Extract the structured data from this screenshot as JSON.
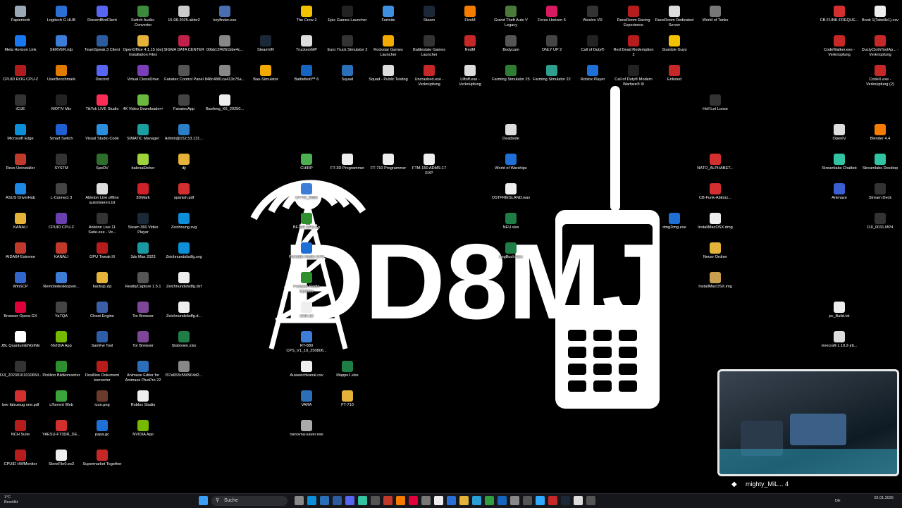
{
  "wallpaper": {
    "callsign": "DD8MJ"
  },
  "icons": [
    {
      "label": "Papierkorb",
      "color": "#9aa7b4",
      "icon": "recycle-bin-icon"
    },
    {
      "label": "Logitech G HUB",
      "color": "#2a6fd6",
      "icon": "logitech-icon"
    },
    {
      "label": "DiscordBotClient",
      "color": "#5865f2",
      "icon": "discord-icon"
    },
    {
      "label": "Switch Audio-Converter",
      "color": "#3b8b3b",
      "icon": "audio-converter-icon"
    },
    {
      "label": "15-08-2025.abbv2",
      "color": "#cccccc",
      "icon": "file-icon"
    },
    {
      "label": "keyfinder.exe",
      "color": "#4a6fb0",
      "icon": "app-icon"
    },
    {
      "label": "Meta Horizon Link",
      "color": "#1877f2",
      "icon": "meta-icon"
    },
    {
      "label": "SERVER.rdp",
      "color": "#3d7dd8",
      "icon": "rdp-icon"
    },
    {
      "label": "TeamSpeak 3 Client",
      "color": "#2c5b9e",
      "icon": "teamspeak-icon"
    },
    {
      "label": "OpenOffice 4.1.15 (de) Installation Files",
      "color": "#e5b23a",
      "icon": "folder-icon"
    },
    {
      "label": "SIGMA DATA CENTER",
      "color": "#c0204a",
      "icon": "sigma-icon"
    },
    {
      "label": "00bb12f4261bbe4c...",
      "color": "#888888",
      "icon": "file-icon"
    },
    {
      "label": "CPUID ROG CPU-Z",
      "color": "#b01c1c",
      "icon": "cpuz-icon"
    },
    {
      "label": "UserBenchmark",
      "color": "#e07b00",
      "icon": "benchmark-icon"
    },
    {
      "label": "Discord",
      "color": "#5865f2",
      "icon": "discord-icon"
    },
    {
      "label": "Virtual CloneDrive",
      "color": "#7a3fb8",
      "icon": "clonedrive-icon"
    },
    {
      "label": "Fanatec Control Panel",
      "color": "#555555",
      "icon": "fanatec-icon"
    },
    {
      "label": "848c4881ca413c75a...",
      "color": "#888888",
      "icon": "file-icon"
    },
    {
      "label": "iCUE",
      "color": "#333333",
      "icon": "icue-icon"
    },
    {
      "label": "MOTIV Mix",
      "color": "#222222",
      "icon": "motiv-icon"
    },
    {
      "label": "TikTok LIVE Studio",
      "color": "#fe2c55",
      "icon": "tiktok-icon"
    },
    {
      "label": "4K Video Downloader+",
      "color": "#69b83f",
      "icon": "video-downloader-icon"
    },
    {
      "label": "FanatecApp",
      "color": "#444444",
      "icon": "fanatec-icon"
    },
    {
      "label": "Baofeng_K6_20250...",
      "color": "#eeeeee",
      "icon": "file-icon"
    },
    {
      "label": "Microsoft Edge",
      "color": "#0c8fd8",
      "icon": "edge-icon"
    },
    {
      "label": "Smart Switch",
      "color": "#1f5fd1",
      "icon": "smart-switch-icon"
    },
    {
      "label": "Visual Studio Code",
      "color": "#2b8fe0",
      "icon": "vscode-icon"
    },
    {
      "label": "SIMATIC Manager",
      "color": "#1aa0a0",
      "icon": "simatic-icon"
    },
    {
      "label": "Admin@152.53.131...",
      "color": "#2a7fc8",
      "icon": "rdp-icon"
    },
    {
      "label": "Revo Uninstaller",
      "color": "#c0392b",
      "icon": "revo-icon"
    },
    {
      "label": "SYSTM",
      "color": "#333333",
      "icon": "systm-icon"
    },
    {
      "label": "SpeDV",
      "color": "#2d6e2d",
      "icon": "spedv-icon"
    },
    {
      "label": "balenaEtcher",
      "color": "#9ed33c",
      "icon": "etcher-icon"
    },
    {
      "label": "dji",
      "color": "#e5b23a",
      "icon": "folder-icon"
    },
    {
      "label": "ASUS DriverHub",
      "color": "#1e88e5",
      "icon": "asus-icon"
    },
    {
      "label": "L-Connect 3",
      "color": "#444444",
      "icon": "lconnect-icon"
    },
    {
      "label": "Ableton Live offline autorisieren.txt",
      "color": "#dddddd",
      "icon": "text-file-icon"
    },
    {
      "label": "3DMark",
      "color": "#d0202a",
      "icon": "3dmark-icon"
    },
    {
      "label": "spanish.pdf",
      "color": "#d32f2f",
      "icon": "pdf-icon"
    },
    {
      "label": "KANALI",
      "color": "#e5b23a",
      "icon": "folder-icon"
    },
    {
      "label": "CPUID CPU-Z",
      "color": "#6b3fb0",
      "icon": "cpuz-icon"
    },
    {
      "label": "Ableton Live 11 Suite.exe - Ve...",
      "color": "#333333",
      "icon": "ableton-icon"
    },
    {
      "label": "Steam 360 Video Player",
      "color": "#1b2838",
      "icon": "steam-icon"
    },
    {
      "label": "Zeichnung.svg",
      "color": "#0c8fd8",
      "icon": "edge-icon"
    },
    {
      "label": "AIDA64 Extreme",
      "color": "#c0392b",
      "icon": "aida-icon"
    },
    {
      "label": "KANALI",
      "color": "#c0392b",
      "icon": "app-icon"
    },
    {
      "label": "GPU Tweak III",
      "color": "#b71c1c",
      "icon": "gpu-tweak-icon"
    },
    {
      "label": "3ds Max 2023",
      "color": "#1a9aa0",
      "icon": "3dsmax-icon"
    },
    {
      "label": "Zeichnundsfsdfg.svg",
      "color": "#0c8fd8",
      "icon": "edge-icon"
    },
    {
      "label": "WinSCP",
      "color": "#3366cc",
      "icon": "winscp-icon"
    },
    {
      "label": "Remotedesktopver...",
      "color": "#3d7dd8",
      "icon": "rdp-icon"
    },
    {
      "label": "backup.zip",
      "color": "#e5b23a",
      "icon": "zip-icon"
    },
    {
      "label": "RealityCapture 1.5.1",
      "color": "#555555",
      "icon": "realitycapture-icon"
    },
    {
      "label": "Zeichnundsfsdfg.dxf",
      "color": "#eeeeee",
      "icon": "file-icon"
    },
    {
      "label": "Browser Opera GX",
      "color": "#e0003a",
      "icon": "opera-icon"
    },
    {
      "label": "YaTQA",
      "color": "#444444",
      "icon": "yatqa-icon"
    },
    {
      "label": "Cheat Engine",
      "color": "#3a5fa8",
      "icon": "cheat-engine-icon"
    },
    {
      "label": "Tor Browser",
      "color": "#7d4698",
      "icon": "tor-icon"
    },
    {
      "label": "Zeichnundsfsdfg.d...",
      "color": "#eeeeee",
      "icon": "file-icon"
    },
    {
      "label": "JBL QuantumENGINE",
      "color": "#ffffff",
      "icon": "jbl-icon"
    },
    {
      "label": "NVIDIA App",
      "color": "#76b900",
      "icon": "nvidia-icon"
    },
    {
      "label": "SamFw Tool",
      "color": "#2f5ea8",
      "icon": "samfw-icon"
    },
    {
      "label": "Tor Browser",
      "color": "#7d4698",
      "icon": "tor-icon"
    },
    {
      "label": "Stationen.xlsx",
      "color": "#1e7e45",
      "icon": "excel-icon"
    },
    {
      "label": "DJI_20230101010650...",
      "color": "#333333",
      "icon": "video-file-icon"
    },
    {
      "label": "Pixillion Bildkonverter",
      "color": "#2d8f2d",
      "icon": "pixillion-icon"
    },
    {
      "label": "Doxillion Dokument konverter",
      "color": "#b71c1c",
      "icon": "doxillion-icon"
    },
    {
      "label": "Animaze Editor for Animaze PlusPro 22",
      "color": "#2b6fb8",
      "icon": "animaze-icon"
    },
    {
      "label": "f37a653c550904d2...",
      "color": "#888888",
      "icon": "file-icon"
    },
    {
      "label": "lore fahrzeug one.pdf",
      "color": "#d32f2f",
      "icon": "pdf-icon"
    },
    {
      "label": "uTorrent Web",
      "color": "#3aa53a",
      "icon": "utorrent-icon"
    },
    {
      "label": "icon.png",
      "color": "#6a3a2a",
      "icon": "image-file-icon"
    },
    {
      "label": "Roblox Studio",
      "color": "#eeeeee",
      "icon": "roblox-icon"
    },
    {
      "label": "NCH Suite",
      "color": "#b71c1c",
      "icon": "nch-icon"
    },
    {
      "label": "YAESU-FT3DR_DE...",
      "color": "#d32f2f",
      "icon": "pdf-icon"
    },
    {
      "label": "papa.gc",
      "color": "#1e6fd6",
      "icon": "app-icon"
    },
    {
      "label": "NVIDIA App",
      "color": "#76b900",
      "icon": "nvidia-icon"
    },
    {
      "label": "CPUID HWMonitor",
      "color": "#b71c1c",
      "icon": "hwmonitor-icon"
    },
    {
      "label": "StoreFile0.es3",
      "color": "#eeeeee",
      "icon": "file-icon"
    },
    {
      "label": "Supermarket Together",
      "color": "#c62828",
      "icon": "game-icon"
    },
    {
      "label": "CHIRP",
      "color": "#4caf50",
      "icon": "chirp-icon"
    },
    {
      "label": "FT-3D Programmer",
      "color": "#eeeeee",
      "icon": "programmer-icon"
    },
    {
      "label": "FT-710 Programmer",
      "color": "#eeeeee",
      "icon": "programmer-icon"
    },
    {
      "label": "FTM-150 ADMS-17 EXP",
      "color": "#eeeeee",
      "icon": "programmer-icon"
    },
    {
      "label": "DYYR_RMB",
      "color": "#3d7dd8",
      "icon": "app-icon"
    },
    {
      "label": "BF-AR CPS En",
      "color": "#2d8f2d",
      "icon": "app-icon"
    },
    {
      "label": "Portable Radio CPS",
      "color": "#1e6fd6",
      "icon": "app-icon"
    },
    {
      "label": "Portable Radio Updater",
      "color": "#2d8f2d",
      "icon": "app-icon"
    },
    {
      "label": "DSK.dll",
      "color": "#eeeeee",
      "icon": "file-icon"
    },
    {
      "label": "RT-880 CPS_V1_10_250806...",
      "color": "#3d7dd8",
      "icon": "app-icon"
    },
    {
      "label": "Ausweichkanal.csv",
      "color": "#eeeeee",
      "icon": "csv-icon"
    },
    {
      "label": "Mappe1.xlsx",
      "color": "#1e7e45",
      "icon": "excel-icon"
    },
    {
      "label": "VARA",
      "color": "#2b6fb8",
      "icon": "vara-icon"
    },
    {
      "label": "FT-710",
      "color": "#e5b23a",
      "icon": "folder-icon"
    },
    {
      "label": "nanovna-saver.exe",
      "color": "#aaaaaa",
      "icon": "app-icon"
    },
    {
      "label": "The Crew 2",
      "color": "#f2c200",
      "icon": "game-icon"
    },
    {
      "label": "Epic Games Launcher",
      "color": "#222222",
      "icon": "epic-icon"
    },
    {
      "label": "Fortnite",
      "color": "#3f8fe0",
      "icon": "fortnite-icon"
    },
    {
      "label": "Steam",
      "color": "#1b2838",
      "icon": "steam-icon"
    },
    {
      "label": "FiveM",
      "color": "#f57c00",
      "icon": "fivem-icon"
    },
    {
      "label": "Grand Theft Auto V Legacy",
      "color": "#4a7a3a",
      "icon": "gta-icon"
    },
    {
      "label": "Forza Horizon 5",
      "color": "#d81b60",
      "icon": "forza-icon"
    },
    {
      "label": "Weelco VR",
      "color": "#333333",
      "icon": "vr-icon"
    },
    {
      "label": "RaceRoom Racing Experience",
      "color": "#b71c1c",
      "icon": "raceroom-icon"
    },
    {
      "label": "RaceRoom Dedicated Server",
      "color": "#dddddd",
      "icon": "raceroom-icon"
    },
    {
      "label": "World of Tanks",
      "color": "#777777",
      "icon": "wot-icon"
    },
    {
      "label": "SteamVR",
      "color": "#1b2838",
      "icon": "steamvr-icon"
    },
    {
      "label": "TruckersMP",
      "color": "#dddddd",
      "icon": "truckersmp-icon"
    },
    {
      "label": "Euro Truck Simulator 2",
      "color": "#333333",
      "icon": "ets2-icon"
    },
    {
      "label": "Rockstar Games Launcher",
      "color": "#f2a900",
      "icon": "rockstar-icon"
    },
    {
      "label": "Battlestate Games Launcher",
      "color": "#333333",
      "icon": "battlestate-icon"
    },
    {
      "label": "RedM",
      "color": "#c62828",
      "icon": "redm-icon"
    },
    {
      "label": "Bodycam",
      "color": "#555555",
      "icon": "bodycam-icon"
    },
    {
      "label": "ONLY UP 2",
      "color": "#444444",
      "icon": "game-icon"
    },
    {
      "label": "Call of Duty®",
      "color": "#222222",
      "icon": "cod-icon"
    },
    {
      "label": "Red Dead Redemption 2",
      "color": "#b71c1c",
      "icon": "rdr2-icon"
    },
    {
      "label": "Stumble Guys",
      "color": "#f2c200",
      "icon": "stumble-icon"
    },
    {
      "label": "Bau-Simulator",
      "color": "#f2a900",
      "icon": "game-icon"
    },
    {
      "label": "Battlefield™ 6",
      "color": "#1565c0",
      "icon": "battlefield-icon"
    },
    {
      "label": "Squad",
      "color": "#2b6fb8",
      "icon": "squad-icon"
    },
    {
      "label": "Squad - Public Testing",
      "color": "#dddddd",
      "icon": "squad-icon"
    },
    {
      "label": "Uncrashed.exe - Verknüpfung",
      "color": "#c62828",
      "icon": "game-icon"
    },
    {
      "label": "Liftoff.exe - Verknüpfung",
      "color": "#dddddd",
      "icon": "game-icon"
    },
    {
      "label": "Farming Simulator 25",
      "color": "#2e7d32",
      "icon": "farming-icon"
    },
    {
      "label": "Farming Simulator 22",
      "color": "#2e9e8e",
      "icon": "farming-icon"
    },
    {
      "label": "Roblox Player",
      "color": "#1e6fd6",
      "icon": "roblox-icon"
    },
    {
      "label": "Call of Duty® Modern Warfare® III",
      "color": "#222222",
      "icon": "cod-icon"
    },
    {
      "label": "Enlisted",
      "color": "#c62828",
      "icon": "enlisted-icon"
    },
    {
      "label": "Hell Let Loose",
      "color": "#333333",
      "icon": "hll-icon"
    },
    {
      "label": "Deadside",
      "color": "#dddddd",
      "icon": "deadside-icon"
    },
    {
      "label": "World of Warships",
      "color": "#1e6fd6",
      "icon": "wows-icon"
    },
    {
      "label": "OSTFRIESLAND.wav",
      "color": "#eeeeee",
      "icon": "audio-file-icon"
    },
    {
      "label": "NEU.xlsx",
      "color": "#1e7e45",
      "icon": "excel-icon"
    },
    {
      "label": "LogBuch.xlsx",
      "color": "#1e7e45",
      "icon": "excel-icon"
    },
    {
      "label": "NATO_ALPHABET...",
      "color": "#d32f2f",
      "icon": "pdf-icon"
    },
    {
      "label": "CB-Funk-Abkürz...",
      "color": "#d32f2f",
      "icon": "pdf-icon"
    },
    {
      "label": "dmg2img.exe",
      "color": "#1e6fd6",
      "icon": "app-icon"
    },
    {
      "label": "InstallMacOSX.dmg",
      "color": "#eeeeee",
      "icon": "file-icon"
    },
    {
      "label": "Neuer Ordner",
      "color": "#e5b23a",
      "icon": "folder-icon"
    },
    {
      "label": "InstallMacOSX.img",
      "color": "#c8a050",
      "icon": "disk-image-icon"
    },
    {
      "label": "CB-FUNK-FREQUE...",
      "color": "#d32f2f",
      "icon": "pdf-icon"
    },
    {
      "label": "Book 1(Tabelle1).csv",
      "color": "#eeeeee",
      "icon": "csv-icon"
    },
    {
      "label": "CodeWalker.exe - Verknüpfung",
      "color": "#c62828",
      "icon": "app-icon"
    },
    {
      "label": "DuctyClothToolAp... - Verknüpfung",
      "color": "#c62828",
      "icon": "app-icon"
    },
    {
      "label": "CodeX.exe - Verknüpfung (2)",
      "color": "#c62828",
      "icon": "app-icon"
    },
    {
      "label": "OpenIV",
      "color": "#dddddd",
      "icon": "openiv-icon"
    },
    {
      "label": "Blender 4.4",
      "color": "#f57c00",
      "icon": "blender-icon"
    },
    {
      "label": "Streamlabs Chatbot",
      "color": "#31c3a2",
      "icon": "streamlabs-icon"
    },
    {
      "label": "Streamlabs Desktop",
      "color": "#31c3a2",
      "icon": "streamlabs-icon"
    },
    {
      "label": "Animaze",
      "color": "#3a5fd0",
      "icon": "animaze-icon"
    },
    {
      "label": "Stream Deck",
      "color": "#333333",
      "icon": "streamdeck-icon"
    },
    {
      "label": "DJI_0031.MP4",
      "color": "#333333",
      "icon": "video-file-icon"
    },
    {
      "label": "pc_Build.txt",
      "color": "#eeeeee",
      "icon": "text-file-icon"
    },
    {
      "label": "vivecraft-1.19.2-jrb...",
      "color": "#dddddd",
      "icon": "file-icon"
    },
    {
      "label": "Bambu Studio",
      "color": "#2e9e3e",
      "icon": "bambu-icon"
    },
    {
      "label": "LaserMakerSpace",
      "color": "#3d7dd8",
      "icon": "laser-icon"
    }
  ],
  "taskbar": {
    "weather_temp": "1°C",
    "weather_text": "Bewölkt",
    "search_placeholder": "Suche",
    "language": "DE",
    "time": "",
    "date": "02.01.2026",
    "apps": [
      {
        "icon": "start-icon",
        "color": "#3a9ff5"
      },
      {
        "icon": "task-view-icon",
        "color": "#888888"
      },
      {
        "icon": "edge-icon",
        "color": "#0c8fd8"
      },
      {
        "icon": "store-icon",
        "color": "#2b6fb8"
      },
      {
        "icon": "teamspeak-icon",
        "color": "#2c5b9e"
      },
      {
        "icon": "discord-icon",
        "color": "#5865f2"
      },
      {
        "icon": "streamlabs-icon",
        "color": "#31c3a2"
      },
      {
        "icon": "app-icon",
        "color": "#555555"
      },
      {
        "icon": "aida-icon",
        "color": "#c0392b"
      },
      {
        "icon": "office-icon",
        "color": "#f57c00"
      },
      {
        "icon": "opera-icon",
        "color": "#e0003a"
      },
      {
        "icon": "app-icon",
        "color": "#777777"
      },
      {
        "icon": "notion-icon",
        "color": "#eeeeee"
      },
      {
        "icon": "app-icon",
        "color": "#2a6fd6"
      },
      {
        "icon": "explorer-icon",
        "color": "#e5b23a"
      },
      {
        "icon": "app-icon",
        "color": "#2a9fd6"
      },
      {
        "icon": "xbox-icon",
        "color": "#2e9e3e"
      },
      {
        "icon": "app-icon",
        "color": "#1565c0"
      },
      {
        "icon": "app-icon",
        "color": "#888888"
      },
      {
        "icon": "app-icon",
        "color": "#555555"
      },
      {
        "icon": "photoshop-icon",
        "color": "#31a8ff"
      },
      {
        "icon": "app-icon",
        "color": "#c62828"
      },
      {
        "icon": "steam-icon",
        "color": "#1b2838"
      },
      {
        "icon": "app-icon",
        "color": "#dddddd"
      },
      {
        "icon": "app-icon",
        "color": "#555555"
      }
    ]
  },
  "webcam": {
    "streamer_name": "mighty_MiL... 4"
  }
}
